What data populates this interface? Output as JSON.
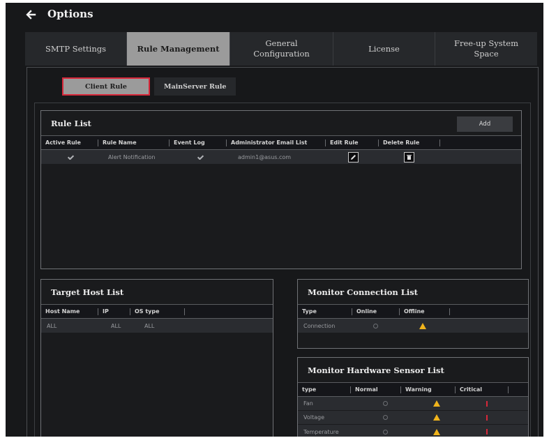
{
  "header": {
    "title": "Options"
  },
  "tabs": [
    {
      "label": "SMTP Settings",
      "active": false
    },
    {
      "label": "Rule Management",
      "active": true
    },
    {
      "label": "General\nConfiguration",
      "active": false
    },
    {
      "label": "License",
      "active": false
    },
    {
      "label": "Free-up System\nSpace",
      "active": false
    }
  ],
  "subtabs": [
    {
      "label": "Client Rule",
      "active": true
    },
    {
      "label": "MainServer Rule",
      "active": false
    }
  ],
  "rule_list": {
    "title": "Rule List",
    "add_label": "Add",
    "columns": [
      "Active Rule",
      "Rule Name",
      "Event Log",
      "Administrator Email List",
      "Edit Rule",
      "Delete Rule"
    ],
    "rows": [
      {
        "active": true,
        "name": "Alert Notification",
        "event_log": true,
        "email": "admin1@asus.com"
      }
    ]
  },
  "target_host_list": {
    "title": "Target Host List",
    "columns": [
      "Host Name",
      "IP",
      "OS type"
    ],
    "rows": [
      {
        "host": "ALL",
        "ip": "ALL",
        "os": "ALL"
      }
    ]
  },
  "monitor_connection_list": {
    "title": "Monitor Connection List",
    "columns": [
      "Type",
      "Online",
      "Offline"
    ],
    "rows": [
      {
        "type": "Connection",
        "online": "normal",
        "offline": "warning"
      }
    ]
  },
  "monitor_hardware_sensor_list": {
    "title": "Monitor Hardware Sensor List",
    "columns": [
      "type",
      "Normal",
      "Warning",
      "Critical"
    ],
    "rows": [
      {
        "type": "Fan"
      },
      {
        "type": "Voltage"
      },
      {
        "type": "Temperature"
      }
    ]
  },
  "colors": {
    "background": "#17181a",
    "active_tab": "#9b9b9b",
    "active_outline": "#d8283a",
    "warning": "#f0b41c",
    "critical": "#d8283a"
  }
}
